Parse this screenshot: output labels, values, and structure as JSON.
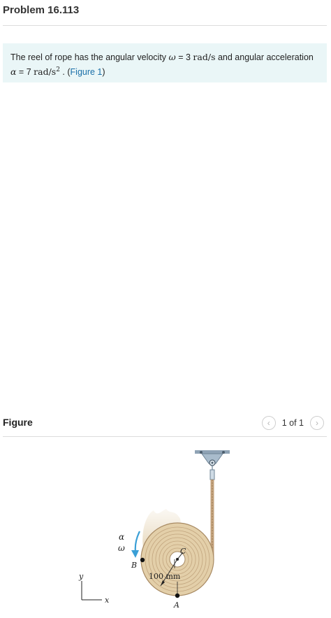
{
  "header": {
    "title": "Problem 16.113"
  },
  "problem": {
    "text1": "The reel of rope has the angular velocity ",
    "omega_symbol": "ω",
    "eq": " = ",
    "omega_value": "3",
    "omega_unit": "rad/s",
    "text2": " and angular acceleration",
    "alpha_symbol": "α",
    "alpha_value": "7",
    "alpha_unit": "rad/s",
    "alpha_exp": "2",
    "text3": " . (",
    "figure_link": "Figure 1",
    "text4": ")"
  },
  "figure_section": {
    "title": "Figure",
    "pager": "1 of 1",
    "prev_icon": "chevron-left-icon",
    "next_icon": "chevron-right-icon"
  },
  "figure": {
    "alpha_label": "α",
    "omega_label": "ω",
    "b_label": "B",
    "c_label": "C",
    "a_label": "A",
    "dim_label": "100 mm",
    "y_label": "y",
    "x_label": "x",
    "colors": {
      "reel": "#e3cfa9",
      "ring": "#b79d78",
      "rope": "#c4a37d",
      "support": "#8fa3b5",
      "arrow": "#3a9fd6",
      "accent": "#1a6fa8"
    }
  }
}
